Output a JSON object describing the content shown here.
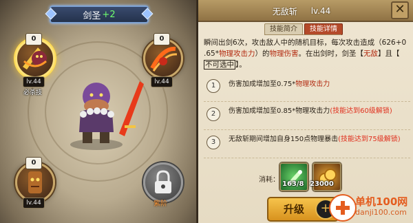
{
  "hero": {
    "name": "剑圣",
    "plus": "+2"
  },
  "skills": [
    {
      "count": "0",
      "level": "lv.44",
      "name": "必杀技",
      "selected": true
    },
    {
      "count": "0",
      "level": "lv.44",
      "name": ""
    },
    {
      "count": "0",
      "level": "lv.44",
      "name": ""
    },
    {
      "locked": true,
      "name": "紫阶"
    }
  ],
  "panel": {
    "skill_name": "无敌斩",
    "skill_level": "lv.44",
    "tabs": [
      "技能简介",
      "技能详情"
    ],
    "active_tab": 1,
    "description": {
      "p1": "瞬间出剑6次，攻击敌人中的随机目标，每次攻击造成（626+0",
      "p2a": ".65*",
      "p2b": "物理攻击力",
      "p2c": "）的",
      "p2d": "物理伤害",
      "p2e": "。在出剑时，剑圣【",
      "p2f": "无敌",
      "p2g": "】且【",
      "p3": "不可选中",
      "p3b": "】。"
    },
    "upgrades": [
      {
        "num": "1",
        "text": "伤害加成增加至0.75*",
        "red": "物理攻击力",
        "lock": ""
      },
      {
        "num": "2",
        "text": "伤害加成增加至0.85*物理攻击力",
        "red": "",
        "lock": "(技能达到60级解锁)"
      },
      {
        "num": "3",
        "text": "无敌斩期间增加自身150点物理暴击",
        "red": "",
        "lock": "(技能达到75级解锁)"
      }
    ],
    "cost_label": "消耗：",
    "costs": [
      {
        "value": "163/8"
      },
      {
        "value": "23000"
      }
    ],
    "upgrade_button": "升级",
    "plus": "+"
  },
  "watermark": {
    "line1": "单机100网",
    "line2": "danji100.com"
  }
}
